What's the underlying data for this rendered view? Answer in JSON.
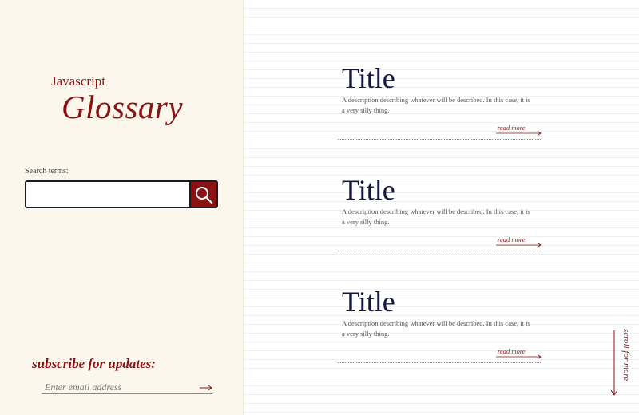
{
  "brand": {
    "top": "Javascript",
    "main": "Glossary"
  },
  "search": {
    "label": "Search terms:",
    "placeholder": "",
    "button_icon": "search-icon"
  },
  "subscribe": {
    "title": "subscribe for updates:",
    "email_placeholder": "Enter email address",
    "submit_icon": "arrow-right-icon"
  },
  "cards": [
    {
      "title": "Title",
      "description": "A description describing whatever will be described. In this case, it is a very silly thing.",
      "read_more": "read more"
    },
    {
      "title": "Title",
      "description": "A description describing whatever will be described. In this case, it is a very silly thing.",
      "read_more": "read more"
    },
    {
      "title": "Title",
      "description": "A description describing whatever will be described. In this case, it is a very silly thing.",
      "read_more": "read more"
    }
  ],
  "scroll_hint": "scroll for more",
  "colors": {
    "accent": "#8b1212",
    "title": "#141640",
    "sidebar_bg": "#fbf7ec"
  }
}
